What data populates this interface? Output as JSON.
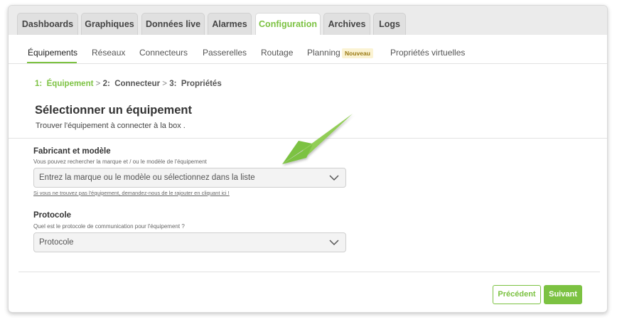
{
  "tabs": [
    {
      "label": "Dashboards",
      "active": false
    },
    {
      "label": "Graphiques",
      "active": false
    },
    {
      "label": "Données live",
      "active": false
    },
    {
      "label": "Alarmes",
      "active": false
    },
    {
      "label": "Configuration",
      "active": true
    },
    {
      "label": "Archives",
      "active": false
    },
    {
      "label": "Logs",
      "active": false
    }
  ],
  "subnav": {
    "items": [
      {
        "label": "Équipements",
        "active": true
      },
      {
        "label": "Réseaux"
      },
      {
        "label": "Connecteurs"
      },
      {
        "label": "Passerelles"
      },
      {
        "label": "Routage"
      },
      {
        "label": "Planning",
        "badge": "Nouveau"
      },
      {
        "label": "Propriétés virtuelles"
      }
    ]
  },
  "steps": {
    "step1_num": "1:",
    "step1_label": "Équipement",
    "sep1": ">",
    "step2_num": "2:",
    "step2_label": "Connecteur",
    "sep2": ">",
    "step3_num": "3:",
    "step3_label": "Propriétés"
  },
  "page": {
    "title": "Sélectionner un équipement",
    "subtitle": "Trouver l'équipement à connecter à la box ."
  },
  "manufacturer": {
    "label": "Fabricant et modèle",
    "hint": "Vous pouvez rechercher la marque et / ou le modèle de l'équipement",
    "placeholder": "Entrez la marque ou le modèle ou sélectionnez dans la liste",
    "link": "Si vous ne trouvez pas l'équipement, demandez-nous de le rajouter en cliquant ici !"
  },
  "protocol": {
    "label": "Protocole",
    "hint": "Quel est le protocole de communication pour l'équipement ?",
    "value": "Protocole"
  },
  "buttons": {
    "prev": "Précédent",
    "next": "Suivant"
  },
  "colors": {
    "accent": "#7cc242",
    "badge_bg": "#fbf3d3",
    "badge_text": "#9a7a14"
  },
  "icons": {
    "dropdown": "chevron-down-icon",
    "annotation": "arrow-annotation"
  }
}
